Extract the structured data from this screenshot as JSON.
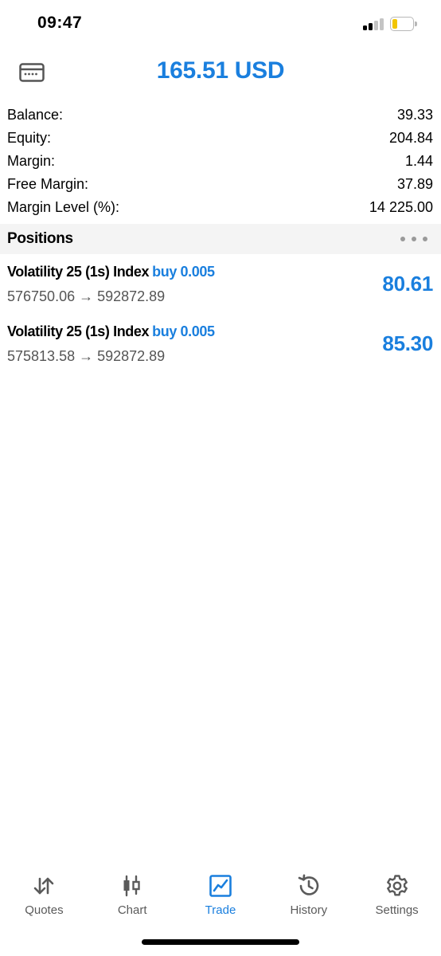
{
  "status_bar": {
    "time": "09:47",
    "signal_icon": "cellular-signal-icon",
    "battery_icon": "battery-icon",
    "battery_color": "#f2c500",
    "battery_level": 0.25
  },
  "header": {
    "title": "165.51 USD",
    "left_icon": "account-card-icon"
  },
  "summary": [
    {
      "label": "Balance:",
      "value": "39.33"
    },
    {
      "label": "Equity:",
      "value": "204.84"
    },
    {
      "label": "Margin:",
      "value": "1.44"
    },
    {
      "label": "Free Margin:",
      "value": "37.89"
    },
    {
      "label": "Margin Level (%):",
      "value": "14 225.00"
    }
  ],
  "positions_section": {
    "title": "Positions",
    "more_icon": "more-options-icon"
  },
  "positions": [
    {
      "symbol": "Volatility 25 (1s) Index",
      "type": "buy 0.005",
      "prices": "576750.06 → 592872.89",
      "profit": "80.61"
    },
    {
      "symbol": "Volatility 25 (1s) Index",
      "type": "buy 0.005",
      "prices": "575813.58 → 592872.89",
      "profit": "85.30"
    }
  ],
  "tabs": [
    {
      "label": "Quotes",
      "icon": "quotes-arrows-icon",
      "active": false
    },
    {
      "label": "Chart",
      "icon": "candlestick-chart-icon",
      "active": false
    },
    {
      "label": "Trade",
      "icon": "trade-chart-icon",
      "active": true
    },
    {
      "label": "History",
      "icon": "history-clock-icon",
      "active": false
    },
    {
      "label": "Settings",
      "icon": "settings-gear-icon",
      "active": false
    }
  ],
  "colors": {
    "accent": "#1a7fde",
    "inactive_tab": "#5a5a5a",
    "section_bg": "#f4f4f4"
  }
}
